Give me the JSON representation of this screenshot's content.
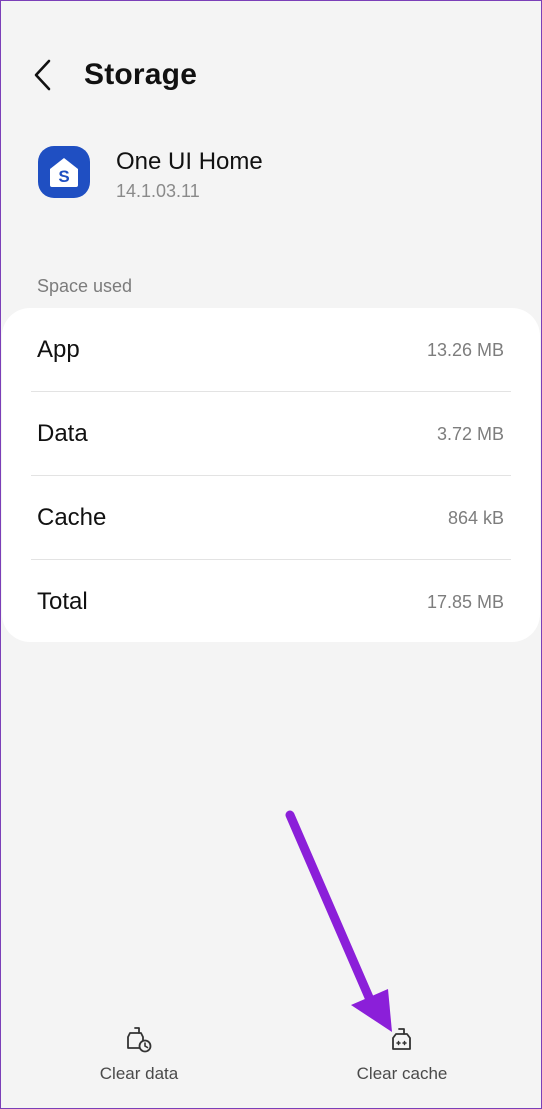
{
  "header": {
    "title": "Storage",
    "back_icon": "chevron-left-icon"
  },
  "app": {
    "name": "One UI Home",
    "version": "14.1.03.11",
    "icon": "one-ui-home-icon",
    "icon_color": "#1f4fc2",
    "icon_letter": "S"
  },
  "space_used": {
    "label": "Space used",
    "rows": [
      {
        "label": "App",
        "value": "13.26 MB"
      },
      {
        "label": "Data",
        "value": "3.72 MB"
      },
      {
        "label": "Cache",
        "value": "864 kB"
      },
      {
        "label": "Total",
        "value": "17.85 MB"
      }
    ]
  },
  "bottom_actions": {
    "clear_data": {
      "label": "Clear data",
      "icon": "clear-data-icon"
    },
    "clear_cache": {
      "label": "Clear cache",
      "icon": "clear-cache-icon"
    }
  },
  "annotation": {
    "arrow_color": "#8b1fd9",
    "points_to": "clear-cache-button"
  }
}
